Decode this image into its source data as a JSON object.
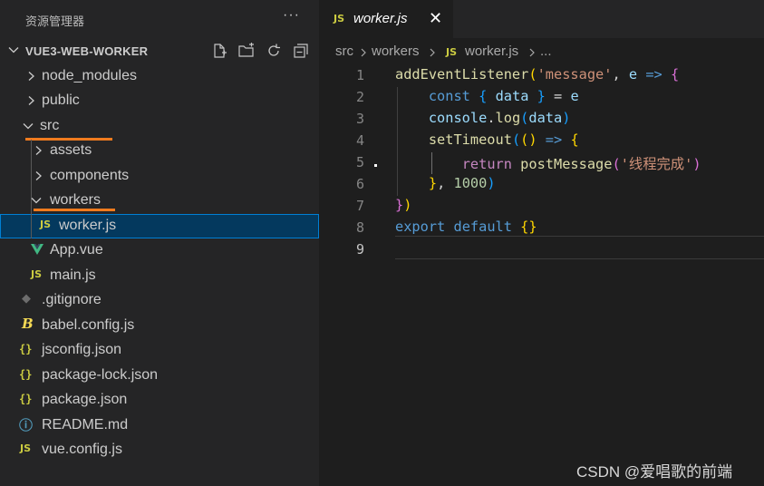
{
  "explorer": {
    "title": "资源管理器",
    "more": "···",
    "project": "VUE3-WEB-WORKER",
    "actions": [
      "new-file-icon",
      "new-folder-icon",
      "refresh-icon",
      "collapse-all-icon"
    ]
  },
  "tree": [
    {
      "label": "node_modules",
      "type": "folder",
      "expanded": false
    },
    {
      "label": "public",
      "type": "folder",
      "expanded": false
    },
    {
      "label": "src",
      "type": "folder",
      "expanded": true
    },
    {
      "label": "assets",
      "type": "folder",
      "expanded": false
    },
    {
      "label": "components",
      "type": "folder",
      "expanded": false
    },
    {
      "label": "workers",
      "type": "folder",
      "expanded": true
    },
    {
      "label": "worker.js",
      "type": "js",
      "icon": "JS"
    },
    {
      "label": "App.vue",
      "type": "vue",
      "icon": "V"
    },
    {
      "label": "main.js",
      "type": "js",
      "icon": "JS"
    },
    {
      "label": ".gitignore",
      "type": "git",
      "icon": "◆"
    },
    {
      "label": "babel.config.js",
      "type": "babel",
      "icon": "B"
    },
    {
      "label": "jsconfig.json",
      "type": "json",
      "icon": "{}"
    },
    {
      "label": "package-lock.json",
      "type": "json",
      "icon": "{}"
    },
    {
      "label": "package.json",
      "type": "json",
      "icon": "{}"
    },
    {
      "label": "README.md",
      "type": "info",
      "icon": "ⓘ"
    },
    {
      "label": "vue.config.js",
      "type": "js",
      "icon": "JS"
    }
  ],
  "tab": {
    "icon": "JS",
    "label": "worker.js",
    "close": "✕"
  },
  "breadcrumb": {
    "items": [
      "src",
      "workers",
      "worker.js",
      "..."
    ],
    "file_icon": "JS"
  },
  "editor": {
    "line_numbers": [
      "1",
      "2",
      "3",
      "4",
      "5",
      "6",
      "7",
      "8",
      "9"
    ],
    "lines": [
      {
        "t": "addEventListener",
        "q": "'message'",
        "v": "e"
      },
      {
        "k": "const",
        "v1": "data",
        "v2": "e"
      },
      {
        "v": "console",
        "f": "log",
        "v2": "data"
      },
      {
        "f": "setTimeout"
      },
      {
        "k": "return",
        "f": "postMessage",
        "s": "'线程完成'"
      },
      {
        "n": "1000"
      },
      {},
      {
        "k1": "export",
        "k2": "default"
      },
      {}
    ]
  },
  "watermark": "CSDN @爱唱歌的前端",
  "colors": {
    "accent": "#007fd4",
    "selection": "#04395e",
    "underline": "#f07b1e",
    "js": "#cbcb41",
    "vue": "#41b883"
  }
}
